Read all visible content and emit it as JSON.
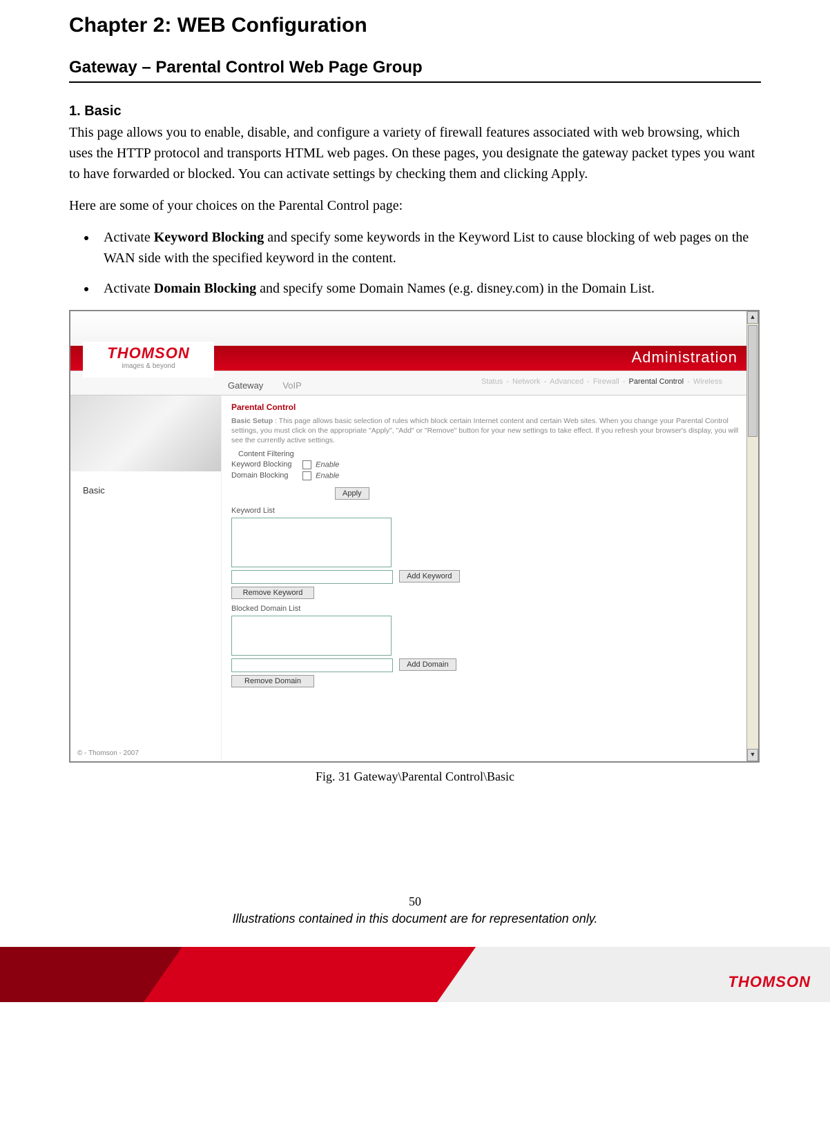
{
  "chapter_title": "Chapter 2: WEB Configuration",
  "section_title": "Gateway – Parental Control Web Page Group",
  "subhead": "1. Basic",
  "para1": "This page allows you to enable, disable, and configure a variety of firewall features associated with web browsing, which uses the HTTP protocol and transports HTML web pages. On these pages, you designate the gateway packet types you want to have forwarded or blocked. You can activate settings by checking them and clicking Apply.",
  "para2": "Here are some of your choices on the Parental Control page:",
  "bullet1_pre": "Activate ",
  "bullet1_bold": "Keyword Blocking",
  "bullet1_post": " and specify some keywords in the Keyword List to cause blocking of web pages on the WAN side with the specified keyword in the content.",
  "bullet2_pre": "Activate ",
  "bullet2_bold": "Domain Blocking",
  "bullet2_post": " and specify some Domain Names (e.g. disney.com) in the Domain List.",
  "figure_caption": "Fig. 31 Gateway\\Parental Control\\Basic",
  "page_number": "50",
  "disclaimer": "Illustrations contained in this document are for representation only.",
  "footer_brand": "THOMSON",
  "screenshot": {
    "logo_brand": "THOMSON",
    "logo_tag": "images & beyond",
    "admin_label": "Administration",
    "tabs": {
      "gateway": "Gateway",
      "voip": "VoIP"
    },
    "subnav": {
      "status": "Status",
      "network": "Network",
      "advanced": "Advanced",
      "firewall": "Firewall",
      "parental": "Parental Control",
      "wireless": "Wireless"
    },
    "side_menu": "Basic",
    "copyright": "© - Thomson - 2007",
    "panel_title": "Parental Control",
    "panel_desc_bold": "Basic Setup",
    "panel_desc": " : This page allows basic selection of rules which block certain Internet content and certain Web sites. When you change your Parental Control settings, you must click on the appropriate \"Apply\", \"Add\" or \"Remove\" button for your new settings to take effect. If you refresh your browser's display, you will see the currently active settings.",
    "content_filtering": "Content Filtering",
    "keyword_blocking": "Keyword Blocking",
    "domain_blocking": "Domain Blocking",
    "enable": "Enable",
    "apply": "Apply",
    "keyword_list": "Keyword List",
    "add_keyword": "Add Keyword",
    "remove_keyword": "Remove Keyword",
    "blocked_domain_list": "Blocked Domain List",
    "add_domain": "Add Domain",
    "remove_domain": "Remove Domain"
  }
}
